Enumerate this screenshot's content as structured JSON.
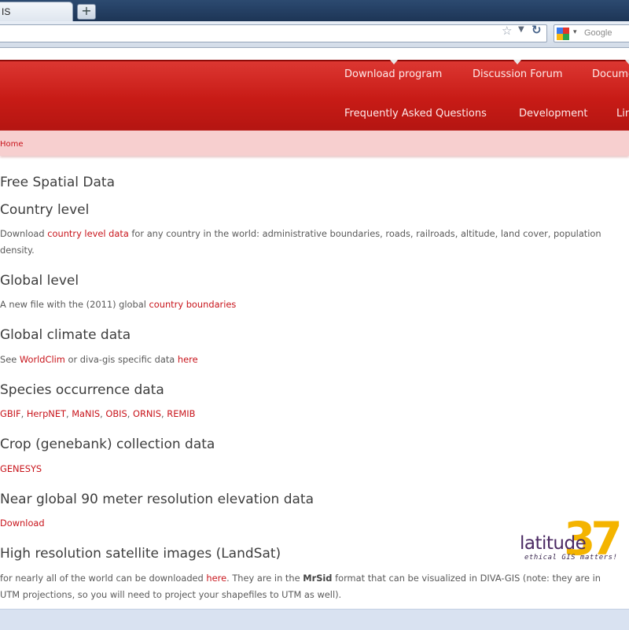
{
  "browser": {
    "tab_title": "IS",
    "new_tab_symbol": "+",
    "search_placeholder": "Google"
  },
  "header": {
    "nav_row1": [
      "Download program",
      "Discussion Forum",
      "Docume"
    ],
    "nav_row2": [
      "Frequently Asked Questions",
      "Development",
      "Lin"
    ]
  },
  "breadcrumb": "Home",
  "content": {
    "page_title": "Free Spatial Data",
    "sections": [
      {
        "heading": "Country level",
        "pre": "Download ",
        "link": "country level data",
        "post": " for any country in the world: administrative boundaries, roads, railroads, altitude, land cover, population density."
      },
      {
        "heading": "Global level",
        "pre": "A new file with the (2011) global ",
        "link": "country boundaries",
        "post": ""
      },
      {
        "heading": "Global climate data",
        "pre": "See ",
        "link": "WorldClim",
        "mid": " or diva-gis specific data ",
        "link2": "here"
      },
      {
        "heading": "Species occurrence data",
        "links": [
          "GBIF",
          "HerpNET",
          "MaNIS",
          "OBIS",
          "ORNIS",
          "REMIB"
        ],
        "sep": ", "
      },
      {
        "heading": "Crop (genebank) collection data",
        "link": "GENESYS"
      },
      {
        "heading": "Near global 90 meter resolution elevation data",
        "link": "Download"
      },
      {
        "heading": "High resolution satellite images (LandSat)",
        "pre": "for nearly all of the world can be downloaded ",
        "link": "here",
        "mid": ". They are in the ",
        "bold": "MrSid",
        "post": " format that can be visualized in DIVA-GIS (note: they are in UTM projections, so you will need to project your shapefiles to UTM as well)."
      }
    ]
  },
  "logo": {
    "word": "latitude",
    "number": "37",
    "tagline": "ethical GIS matters!"
  },
  "colors": {
    "header_red": "#c71b16",
    "breadcrumb_bg": "#f7cfcf",
    "link_red": "#c8141b",
    "logo_yellow": "#f4b400",
    "logo_purple": "#4b2a63"
  }
}
